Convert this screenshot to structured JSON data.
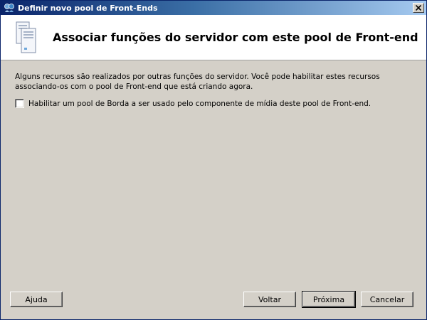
{
  "window": {
    "title": "Definir novo pool de Front-Ends",
    "close_label": "×"
  },
  "header": {
    "title": "Associar funções do servidor com este pool de Front-end",
    "icon": "server-icon"
  },
  "content": {
    "description": "Alguns recursos são realizados por outras funções do servidor. Você pode habilitar estes recursos associando-os com o pool de Front-end que está criando agora.",
    "edge_pool_checkbox": {
      "label": "Habilitar um pool de Borda a ser usado pelo componente de mídia deste pool de Front-end.",
      "checked": false
    }
  },
  "buttons": {
    "help": "Ajuda",
    "back": "Voltar",
    "next": "Próxima",
    "cancel": "Cancelar"
  },
  "colors": {
    "dialog_bg": "#d4d0c8",
    "title_gradient_start": "#0a246a",
    "title_gradient_end": "#a6caf0"
  }
}
